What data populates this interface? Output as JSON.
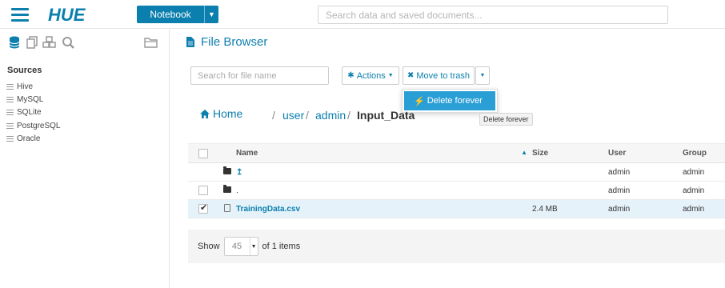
{
  "app": {
    "logo_text": "HUE",
    "brand_color": "#0b7fad"
  },
  "topbar": {
    "notebook_label": "Notebook",
    "search_placeholder": "Search data and saved documents..."
  },
  "sidebar": {
    "icons": [
      "database-icon",
      "copy-icon",
      "cubes-icon",
      "search-icon",
      "folder-open-icon"
    ],
    "sources_title": "Sources",
    "items": [
      {
        "label": "Hive"
      },
      {
        "label": "MySQL"
      },
      {
        "label": "SQLite"
      },
      {
        "label": "PostgreSQL"
      },
      {
        "label": "Oracle"
      }
    ]
  },
  "main": {
    "title": "File Browser",
    "filename_search_placeholder": "Search for file name",
    "actions_label": "Actions",
    "trash_label": "Move to trash",
    "dropdown_item": "Delete forever",
    "tooltip": "Delete forever",
    "breadcrumb": {
      "home": "Home",
      "parts": [
        "user",
        "admin",
        "Input_Data"
      ],
      "separator": "/"
    },
    "table": {
      "columns": [
        "Name",
        "Size",
        "User",
        "Group"
      ],
      "rows": [
        {
          "type": "folder",
          "name": "↥",
          "size": "",
          "user": "admin",
          "group": "admin",
          "checkbox": false,
          "selected": false
        },
        {
          "type": "folder",
          "name": ".",
          "size": "",
          "user": "admin",
          "group": "admin",
          "checkbox": true,
          "selected": false
        },
        {
          "type": "file",
          "name": "TrainingData.csv",
          "size": "2.4 MB",
          "user": "admin",
          "group": "admin",
          "checkbox": true,
          "selected": true
        }
      ]
    },
    "pager": {
      "show_label": "Show",
      "page_size": "45",
      "of_items": "of 1 items"
    }
  }
}
